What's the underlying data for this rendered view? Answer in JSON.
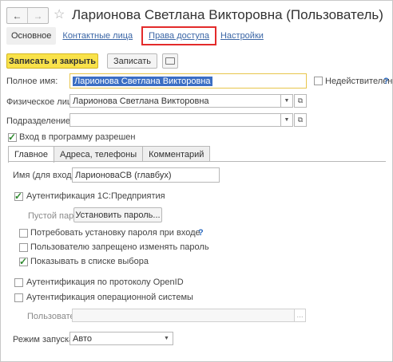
{
  "window": {
    "title": "Ларионова Светлана Викторовна (Пользователь)",
    "back_icon": "arrow-left-icon",
    "forward_icon": "arrow-right-icon",
    "favorite_icon": "star-icon"
  },
  "top_tabs": [
    {
      "label": "Основное"
    },
    {
      "label": "Контактные лица"
    },
    {
      "label": "Права доступа"
    },
    {
      "label": "Настройки"
    }
  ],
  "toolbar": {
    "save_close_label": "Записать и закрыть",
    "save_label": "Записать",
    "comment_icon": "comment-icon"
  },
  "form": {
    "full_name_label": "Полное имя:",
    "full_name_value": "Ларионова Светлана Викторовна",
    "inactive_label": "Недействителен",
    "help_mark": "?",
    "individual_label": "Физическое лицо:",
    "individual_value": "Ларионова Светлана Викторовна",
    "department_label": "Подразделение:",
    "department_value": "",
    "login_allowed_label": "Вход в программу разрешен",
    "login_allowed": true
  },
  "inner_tabs": [
    {
      "label": "Главное"
    },
    {
      "label": "Адреса, телефоны"
    },
    {
      "label": "Комментарий"
    }
  ],
  "main_tab": {
    "login_name_label": "Имя (для входа):",
    "login_name_value": "ЛарионоваСВ (главбух)",
    "auth_1c_label": "Аутентификация 1С:Предприятия",
    "auth_1c": true,
    "empty_password_label": "Пустой пароль",
    "set_password_label": "Установить пароль...",
    "require_password_label": "Потребовать установку пароля при входе",
    "forbid_change_label": "Пользователю запрещено изменять пароль",
    "show_in_list_label": "Показывать в списке выбора",
    "show_in_list": true,
    "openid_label": "Аутентификация по протоколу OpenID",
    "os_auth_label": "Аутентификация операционной системы",
    "os_user_label": "Пользователь:",
    "os_user_value": "",
    "ellipsis": "...",
    "launch_mode_label": "Режим запуска:",
    "launch_mode_value": "Авто"
  },
  "colors": {
    "primary_button": "#f9e24a",
    "link": "#3b66a6",
    "highlight_outline": "#e32b2b",
    "check": "#2e8a2e"
  }
}
